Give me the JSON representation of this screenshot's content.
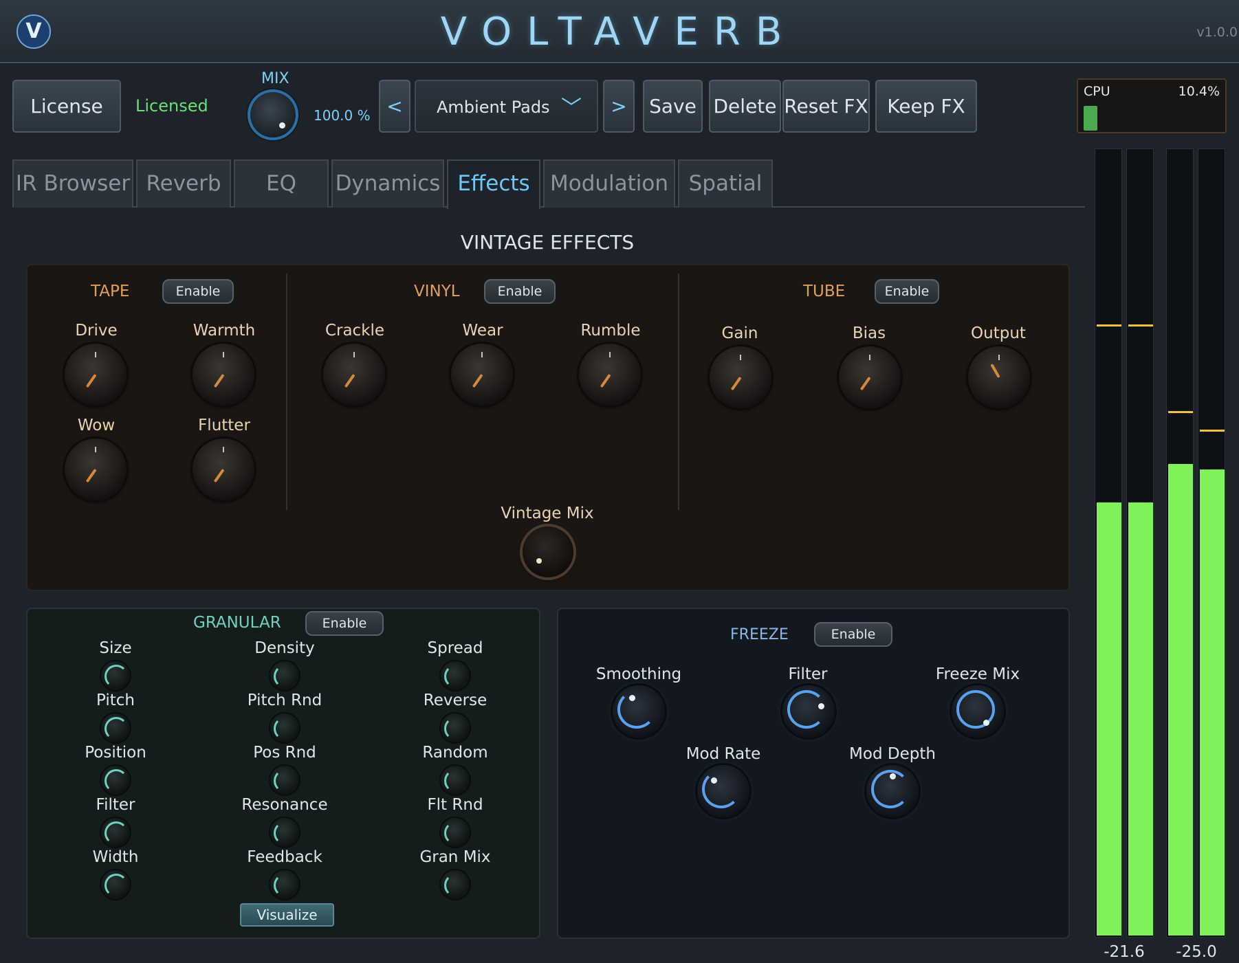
{
  "header": {
    "logo_letter": "V",
    "title": "VOLTAVERB",
    "version": "v1.0.0"
  },
  "toolbar": {
    "license_label": "License",
    "license_status": "Licensed",
    "mix_label": "MIX",
    "mix_value": "100.0 %",
    "prev_label": "<",
    "next_label": ">",
    "preset_name": "Ambient Pads",
    "preset_chevron_icon": "chevron-down-icon",
    "save_label": "Save",
    "delete_label": "Delete",
    "reset_fx_label": "Reset FX",
    "keep_fx_label": "Keep FX"
  },
  "cpu": {
    "label": "CPU",
    "value": "10.4%",
    "level": 0.104
  },
  "tabs": [
    {
      "label": "IR Browser",
      "active": false
    },
    {
      "label": "Reverb",
      "active": false
    },
    {
      "label": "EQ",
      "active": false
    },
    {
      "label": "Dynamics",
      "active": false
    },
    {
      "label": "Effects",
      "active": true
    },
    {
      "label": "Modulation",
      "active": false
    },
    {
      "label": "Spatial",
      "active": false
    }
  ],
  "vintage": {
    "title": "VINTAGE EFFECTS",
    "tape": {
      "title": "TAPE",
      "enable": "Enable",
      "knobs": [
        "Drive",
        "Warmth",
        "Wow",
        "Flutter"
      ]
    },
    "vinyl": {
      "title": "VINYL",
      "enable": "Enable",
      "knobs": [
        "Crackle",
        "Wear",
        "Rumble"
      ]
    },
    "tube": {
      "title": "TUBE",
      "enable": "Enable",
      "knobs": [
        "Gain",
        "Bias",
        "Output"
      ]
    },
    "mix_label": "Vintage Mix"
  },
  "granular": {
    "title": "GRANULAR",
    "enable": "Enable",
    "knobs": [
      [
        "Size",
        "Density",
        "Spread"
      ],
      [
        "Pitch",
        "Pitch Rnd",
        "Reverse"
      ],
      [
        "Position",
        "Pos Rnd",
        "Random"
      ],
      [
        "Filter",
        "Resonance",
        "Flt Rnd"
      ],
      [
        "Width",
        "Feedback",
        "Gran Mix"
      ]
    ],
    "visualize": "Visualize"
  },
  "freeze": {
    "title": "FREEZE",
    "enable": "Enable",
    "knobs": [
      "Smoothing",
      "Filter",
      "Freeze Mix",
      "Mod Rate",
      "Mod Depth"
    ]
  },
  "meters": {
    "left_readout": "-21.6",
    "right_readout": "-25.0",
    "colors": {
      "fill": "#7ff25a",
      "peak": "#f2c23a"
    }
  }
}
